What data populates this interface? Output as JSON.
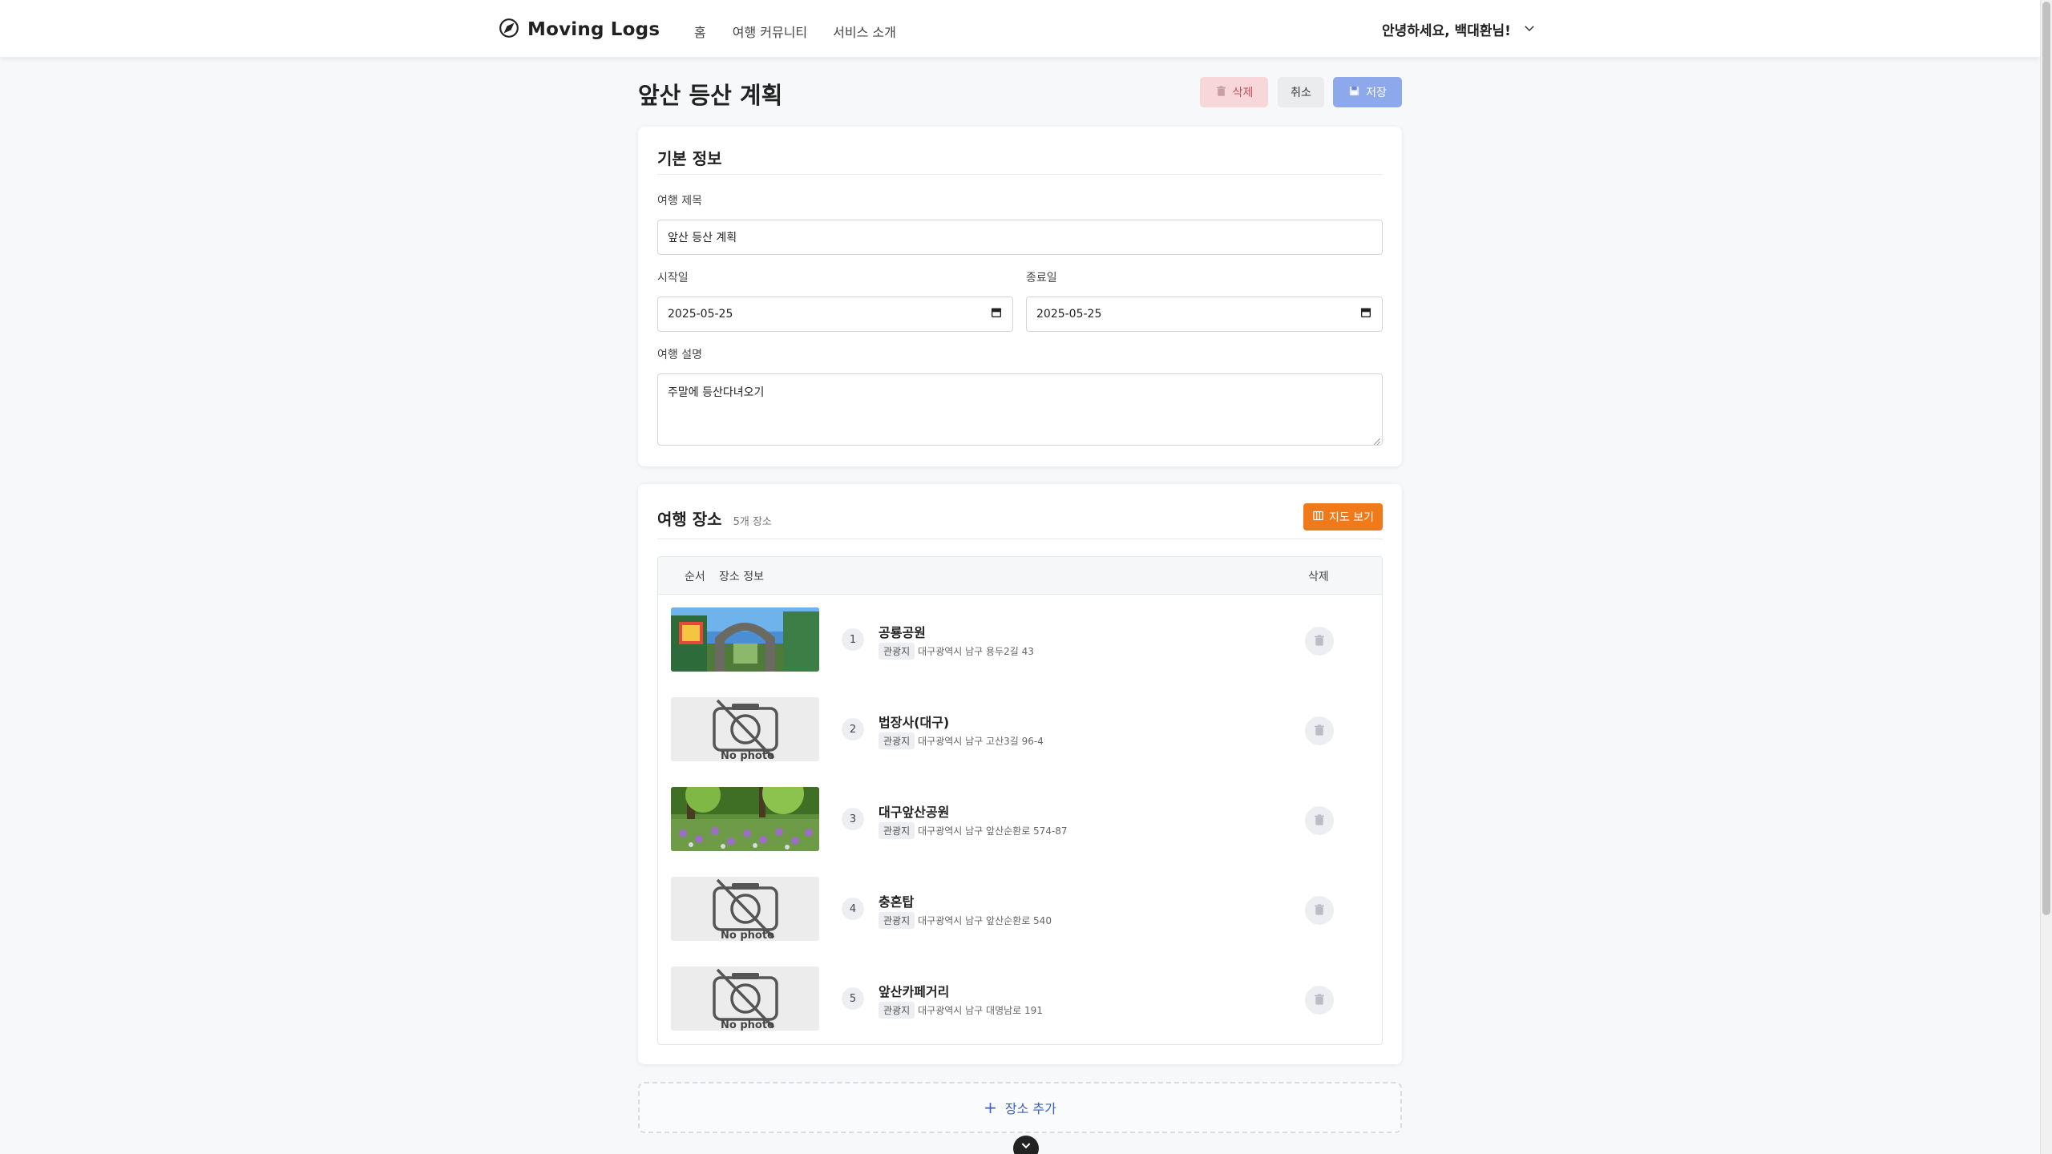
{
  "nav": {
    "brand": "Moving Logs",
    "links": [
      "홈",
      "여행 커뮤니티",
      "서비스 소개"
    ],
    "greeting": "안녕하세요, 백대환님!"
  },
  "page": {
    "title": "앞산 등산 계획",
    "delete_label": "삭제",
    "cancel_label": "취소",
    "save_label": "저장"
  },
  "basic": {
    "heading": "기본 정보",
    "title_label": "여행 제목",
    "title_value": "앞산 등산 계획",
    "start_label": "시작일",
    "start_value": "2025-05-25",
    "end_label": "종료일",
    "end_value": "2025-05-25",
    "desc_label": "여행 설명",
    "desc_value": "주말에 등산다녀오기"
  },
  "places": {
    "heading": "여행 장소",
    "count": "5개 장소",
    "map_label": "지도 보기",
    "col_order": "순서",
    "col_info": "장소 정보",
    "col_delete": "삭제",
    "items": [
      {
        "order": "1",
        "name": "공룡공원",
        "category": "관광지",
        "address": "대구광역시 남구 용두2길 43",
        "photo": "park-gate"
      },
      {
        "order": "2",
        "name": "법장사(대구)",
        "category": "관광지",
        "address": "대구광역시 남구 고산3길 96-4",
        "photo": "none"
      },
      {
        "order": "3",
        "name": "대구앞산공원",
        "category": "관광지",
        "address": "대구광역시 남구 앞산순환로 574-87",
        "photo": "flower-garden"
      },
      {
        "order": "4",
        "name": "충혼탑",
        "category": "관광지",
        "address": "대구광역시 남구 앞산순환로 540",
        "photo": "none"
      },
      {
        "order": "5",
        "name": "앞산카페거리",
        "category": "관광지",
        "address": "대구광역시 남구 대명남로 191",
        "photo": "none"
      }
    ],
    "no_photo_text": "No photo"
  },
  "add_place_label": "장소 추가",
  "colors": {
    "accent_orange": "#f07a1a",
    "save_blue": "#8ea8ec",
    "delete_pink": "#f8d7da",
    "link_blue": "#3a60b5"
  }
}
